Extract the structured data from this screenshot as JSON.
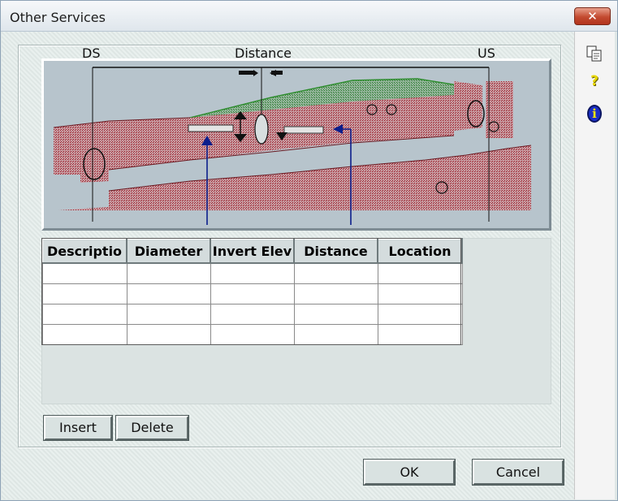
{
  "window": {
    "title": "Other Services",
    "close_glyph": "✕"
  },
  "side_toolbar": {
    "items": [
      {
        "icon": "copy-icon"
      },
      {
        "icon": "help-icon",
        "glyph": "?"
      },
      {
        "icon": "info-icon",
        "glyph": "i"
      }
    ]
  },
  "diagram": {
    "label_ds": "DS",
    "label_distance": "Distance",
    "label_us": "US",
    "colors": {
      "soil": "#9c1f2a",
      "ground": "#3f9a3a",
      "background": "#b7c4cc",
      "arrow": "#0b1e8c"
    }
  },
  "table": {
    "columns": [
      "Descriptio",
      "Diameter",
      "Invert Elev",
      "Distance",
      "Location"
    ],
    "rows": [
      [
        "",
        "",
        "",
        "",
        ""
      ],
      [
        "",
        "",
        "",
        "",
        ""
      ],
      [
        "",
        "",
        "",
        "",
        ""
      ],
      [
        "",
        "",
        "",
        "",
        ""
      ]
    ]
  },
  "buttons": {
    "insert": "Insert",
    "delete": "Delete",
    "ok": "OK",
    "cancel": "Cancel"
  }
}
